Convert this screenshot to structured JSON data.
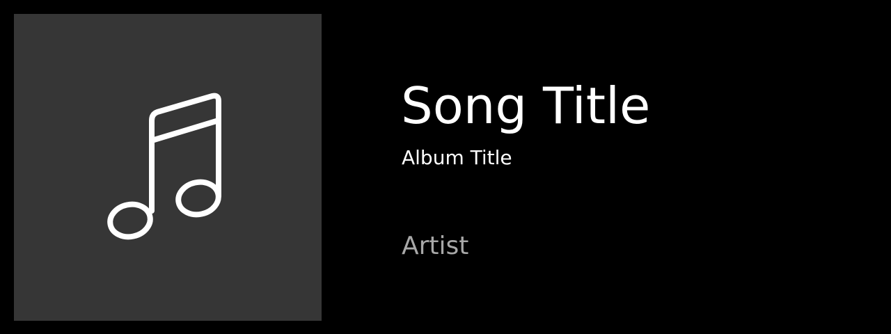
{
  "now_playing": {
    "song_title": "Song Title",
    "album_title": "Album Title",
    "artist": "Artist"
  },
  "album_art": {
    "icon": "music-note-icon",
    "background_color": "#363636",
    "icon_color": "#ffffff"
  },
  "colors": {
    "background": "#000000",
    "primary_text": "#ffffff",
    "secondary_text": "#a8a8a8"
  }
}
